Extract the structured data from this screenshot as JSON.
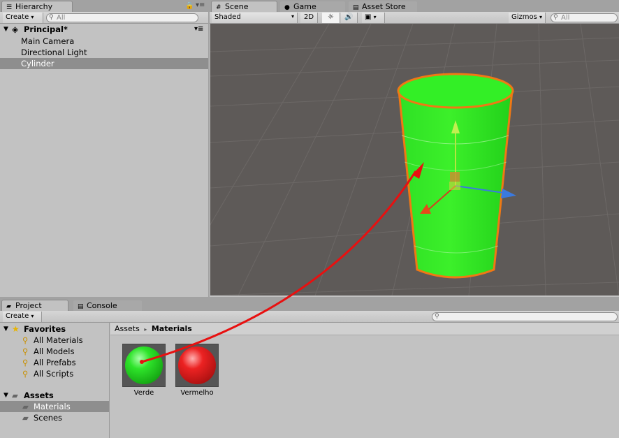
{
  "hierarchy": {
    "tab_label": "Hierarchy",
    "create_label": "Create",
    "search_placeholder": "All",
    "scene_name": "Principal*",
    "items": [
      {
        "label": "Main Camera",
        "selected": false
      },
      {
        "label": "Directional Light",
        "selected": false
      },
      {
        "label": "Cylinder",
        "selected": true
      }
    ]
  },
  "scene_panel": {
    "tabs": [
      {
        "label": "Scene",
        "active": true,
        "icon": "hash-icon"
      },
      {
        "label": "Game",
        "active": false,
        "icon": "game-icon"
      },
      {
        "label": "Asset Store",
        "active": false,
        "icon": "store-icon"
      }
    ],
    "shading_mode": "Shaded",
    "mode_2d": "2D",
    "gizmos_label": "Gizmos",
    "search_placeholder": "All",
    "colors": {
      "background": "#5e5a58",
      "cylinder": "#22e61a",
      "outline": "#f07814",
      "arrow": "#e81010"
    }
  },
  "project": {
    "tabs": [
      {
        "label": "Project",
        "active": true,
        "icon": "folder-icon"
      },
      {
        "label": "Console",
        "active": false,
        "icon": "console-icon"
      }
    ],
    "create_label": "Create",
    "favorites": {
      "label": "Favorites",
      "items": [
        "All Materials",
        "All Models",
        "All Prefabs",
        "All Scripts"
      ]
    },
    "assets": {
      "label": "Assets",
      "items": [
        {
          "label": "Materials",
          "selected": true
        },
        {
          "label": "Scenes",
          "selected": false
        }
      ]
    },
    "breadcrumb": {
      "root": "Assets",
      "separator": "▸",
      "current": "Materials"
    },
    "materials": [
      {
        "name": "Verde",
        "color": "#1fd81f"
      },
      {
        "name": "Vermelho",
        "color": "#e01818"
      }
    ]
  }
}
